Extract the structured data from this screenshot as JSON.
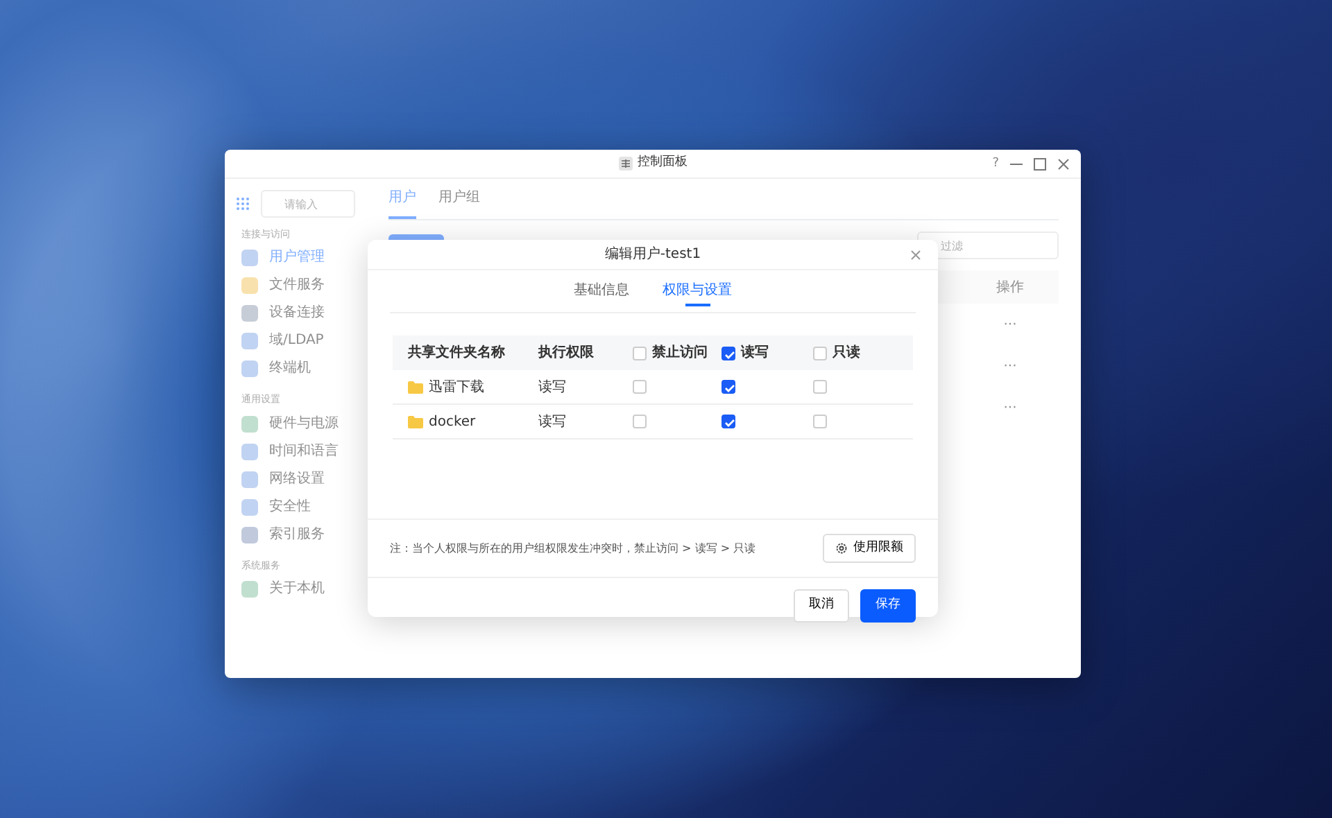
{
  "window": {
    "title": "控制面板",
    "help": "?"
  },
  "sidebar": {
    "search_placeholder": "请输入",
    "sections": [
      {
        "title": "连接与访问",
        "items": [
          {
            "label": "用户管理",
            "selected": true
          },
          {
            "label": "文件服务",
            "selected": false
          },
          {
            "label": "设备连接",
            "selected": false
          },
          {
            "label": "域/LDAP",
            "selected": false
          },
          {
            "label": "终端机",
            "selected": false
          }
        ]
      },
      {
        "title": "通用设置",
        "items": [
          {
            "label": "硬件与电源",
            "selected": false
          },
          {
            "label": "时间和语言",
            "selected": false
          },
          {
            "label": "网络设置",
            "selected": false
          },
          {
            "label": "安全性",
            "selected": false
          },
          {
            "label": "索引服务",
            "selected": false
          }
        ]
      },
      {
        "title": "系统服务",
        "items": [
          {
            "label": "关于本机",
            "selected": false
          }
        ]
      }
    ]
  },
  "content": {
    "tabs": [
      {
        "label": "用户",
        "selected": true
      },
      {
        "label": "用户组",
        "selected": false
      }
    ],
    "filter_placeholder": "过滤",
    "column": "操作",
    "row_actions": [
      "···",
      "···",
      "···"
    ]
  },
  "modal": {
    "title": "编辑用户-test1",
    "tabs": [
      {
        "label": "基础信息",
        "selected": false
      },
      {
        "label": "权限与设置",
        "selected": true
      }
    ],
    "columns": [
      {
        "label": "共享文件夹名称"
      },
      {
        "label": "执行权限"
      },
      {
        "label": "禁止访问",
        "checked": false
      },
      {
        "label": "读写",
        "checked": true
      },
      {
        "label": "只读",
        "checked": false
      }
    ],
    "rows": [
      {
        "name": "迅雷下载",
        "exec": "读写",
        "access": [
          {
            "checked": false
          },
          {
            "checked": true
          },
          {
            "checked": false
          }
        ]
      },
      {
        "name": "docker",
        "exec": "读写",
        "access": [
          {
            "checked": false
          },
          {
            "checked": true
          },
          {
            "checked": false
          }
        ]
      }
    ],
    "note": "注：当个人权限与所在的用户组权限发生冲突时，禁止访问 > 读写 > 只读",
    "quota_button": "使用限额",
    "buttons": [
      {
        "label": "取消",
        "kind": "secondary"
      },
      {
        "label": "保存",
        "kind": "primary"
      }
    ]
  }
}
